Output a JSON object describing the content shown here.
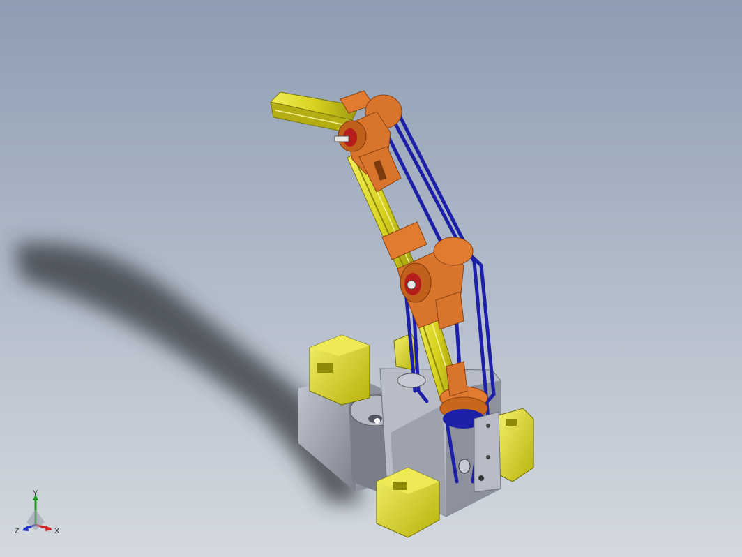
{
  "viewport": {
    "background_top": "#8e9db3",
    "background_bottom": "#d4d9df"
  },
  "model": {
    "colors": {
      "extrusion": "#e2dd28",
      "extrusion_dark": "#8f8a10",
      "bracket": "#d9742c",
      "bracket_dark": "#9c4a16",
      "belt": "#1d1fa6",
      "motor": "#e8e418",
      "housing": "#a8acb8",
      "housing_dark": "#6c707c",
      "shadow": "#2a2c30"
    }
  },
  "triad": {
    "x_label": "X",
    "y_label": "Y",
    "z_label": "Z",
    "x_color": "#d42020",
    "y_color": "#1f9a1f",
    "z_color": "#2030c8"
  }
}
